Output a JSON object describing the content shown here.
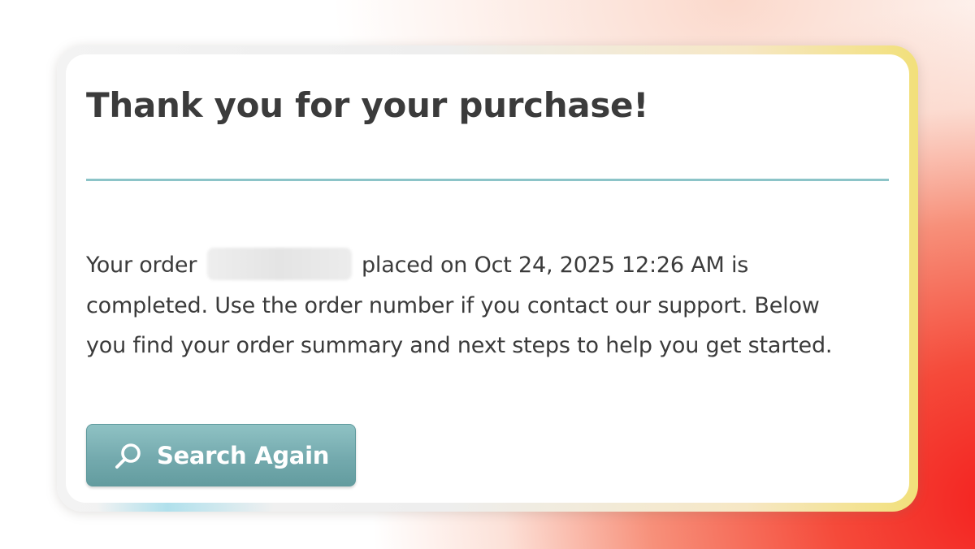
{
  "confirmation": {
    "title": "Thank you for your purchase!",
    "message": {
      "before_order": "Your order",
      "order_number": "",
      "after_order": " placed on Oct 24, 2025 12:26 AM is completed. Use the order number if you contact our support. Below you find your order summary and next steps to help you get started."
    },
    "search_again_button": {
      "label": "Search Again",
      "icon": "search-icon"
    }
  },
  "colors": {
    "divider": "#8cc4c8",
    "button": "#74aaae",
    "text": "#3b3b3b"
  }
}
